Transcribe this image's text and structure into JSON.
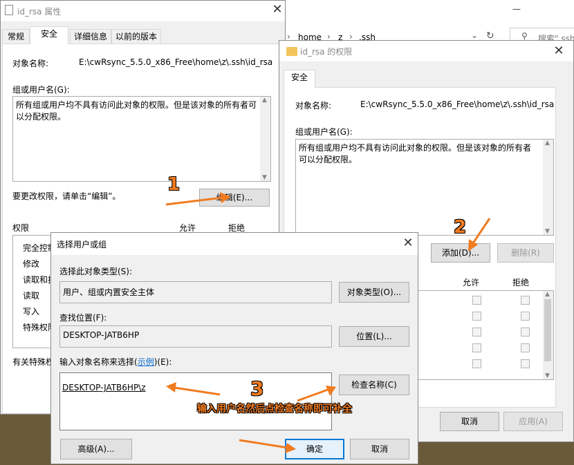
{
  "explorer": {
    "breadcrumb": [
      "home",
      "z",
      ".ssh"
    ],
    "search_placeholder": "搜索\".ssh\""
  },
  "props_window": {
    "title": "id_rsa 属性",
    "tabs": [
      "常规",
      "安全",
      "详细信息",
      "以前的版本"
    ],
    "active_tab": "安全",
    "object_name_label": "对象名称:",
    "object_name_value": "E:\\cwRsync_5.5.0_x86_Free\\home\\z\\.ssh\\id_rsa",
    "group_label": "组或用户名(G):",
    "no_access_msg": "所有组或用户均不具有访问此对象的权限。但是该对象的所有者可以分配权限。",
    "change_hint": "要更改权限，请单击“编辑”。",
    "edit_button": "编辑(E)...",
    "perm_label": "权限",
    "allow_label": "允许",
    "deny_label": "拒绝",
    "perms": [
      "完全控制",
      "修改",
      "读取和执行",
      "读取",
      "写入",
      "特殊权限"
    ],
    "special_hint": "有关特殊权"
  },
  "perm_window": {
    "title": "id_rsa 的权限",
    "tab": "安全",
    "object_name_label": "对象名称:",
    "object_name_value": "E:\\cwRsync_5.5.0_x86_Free\\home\\z\\.ssh\\id_rsa",
    "group_label": "组或用户名(G):",
    "no_access_msg": "所有组或用户均不具有访问此对象的权限。但是该对象的所有者可以分配权限。",
    "add_button": "添加(D)...",
    "remove_button": "删除(R)",
    "allow_label": "允许",
    "deny_label": "拒绝",
    "cancel_button": "取消",
    "apply_button": "应用(A)"
  },
  "select_dialog": {
    "title": "选择用户或组",
    "type_label": "选择此对象类型(S):",
    "type_value": "用户、组或内置安全主体",
    "type_button": "对象类型(O)...",
    "location_label": "查找位置(F):",
    "location_value": "DESKTOP-JATB6HP",
    "location_button": "位置(L)...",
    "enter_label_pre": "输入对象名称来选择(",
    "enter_label_link": "示例",
    "enter_label_post": ")(E):",
    "entered_name": "DESKTOP-JATB6HP\\z",
    "check_button": "检查名称(C)",
    "advanced_button": "高级(A)...",
    "ok_button": "确定",
    "cancel_button": "取消"
  },
  "annotations": {
    "step1": "1",
    "step2": "2",
    "step3": "3",
    "step3_note": "输入用户名然后点检查名称即可补全",
    "arrow_color": "#f07b20"
  }
}
